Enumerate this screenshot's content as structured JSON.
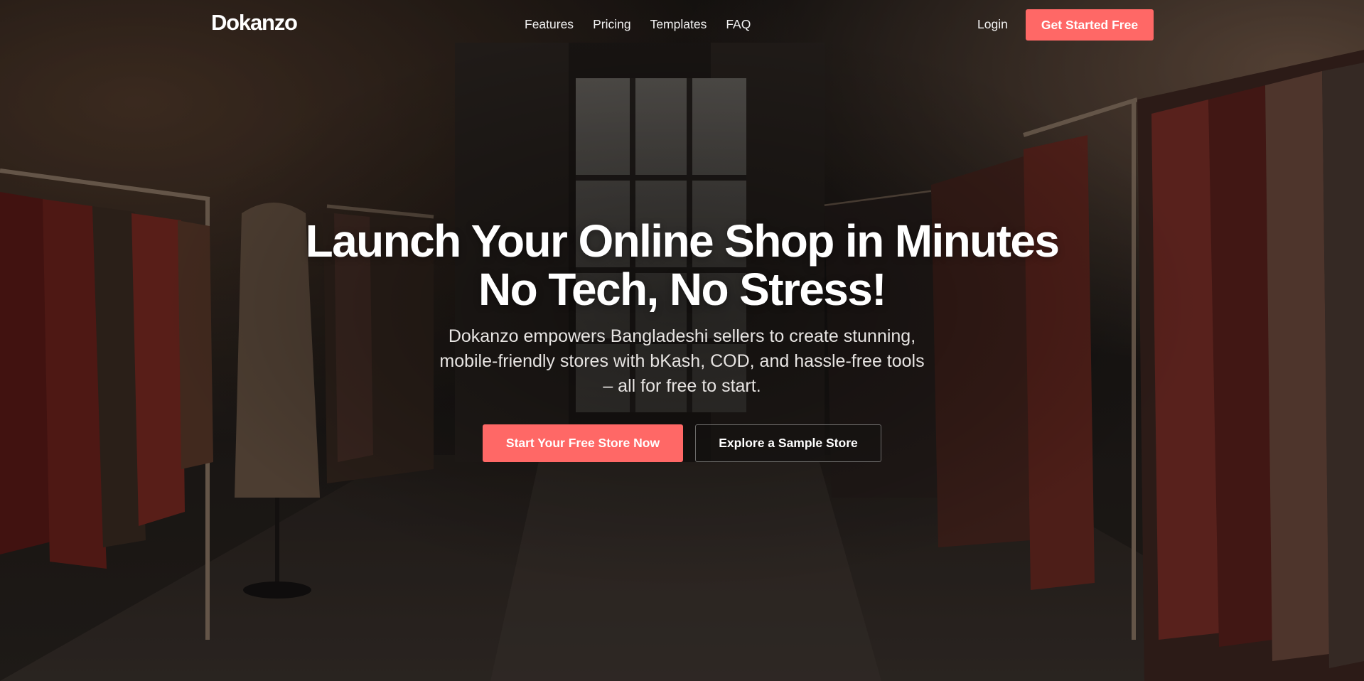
{
  "nav": {
    "logo": "Dokanzo",
    "links": [
      "Features",
      "Pricing",
      "Templates",
      "FAQ"
    ],
    "login": "Login",
    "cta": "Get Started Free"
  },
  "hero": {
    "title_line1": "Launch Your Online Shop in Minutes",
    "title_line2": "No Tech, No Stress!",
    "subtitle_line1": "Dokanzo empowers Bangladeshi sellers to create stunning,",
    "subtitle_line2": "mobile-friendly stores with bKash, COD, and hassle-free tools",
    "subtitle_line3": "– all for free to start.",
    "primary_button": "Start Your Free Store Now",
    "secondary_button": "Explore a Sample Store"
  },
  "colors": {
    "accent": "#ff6866",
    "text": "#ffffff",
    "background": "#0e0c0b"
  },
  "background_image": "dark clothing boutique with garment racks and a window"
}
